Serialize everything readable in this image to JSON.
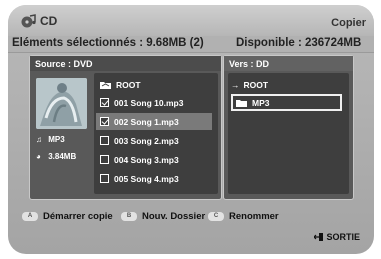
{
  "header": {
    "title": "CD",
    "action": "Copier"
  },
  "info": {
    "selected": "Eléments sélectionnés : 9.68MB  (2)",
    "available": "Disponible : 236724MB"
  },
  "source": {
    "title": "Source : DVD",
    "file_type": "MP3",
    "file_size": "3.84MB",
    "root_label": "ROOT",
    "items": [
      {
        "label": "001 Song 10.mp3",
        "checked": true
      },
      {
        "label": "002 Song 1.mp3",
        "checked": true
      },
      {
        "label": "003 Song 2.mp3",
        "checked": false
      },
      {
        "label": "004 Song 3.mp3",
        "checked": false
      },
      {
        "label": "005 Song 4.mp3",
        "checked": false
      }
    ]
  },
  "destination": {
    "title": "Vers : DD",
    "items": [
      {
        "label": "ROOT",
        "icon": "arrow-right-icon"
      },
      {
        "label": "MP3",
        "icon": "folder-icon"
      }
    ]
  },
  "footer": {
    "buttons": [
      {
        "key": "A",
        "label": "Démarrer copie"
      },
      {
        "key": "B",
        "label": "Nouv. Dossier"
      },
      {
        "key": "C",
        "label": "Renommer"
      }
    ],
    "exit_label": "SORTIE"
  },
  "colors": {
    "background": "#a9a9a9",
    "pane": "#595959",
    "list": "#3e3e3e",
    "selected_row": "#7a7a7a"
  }
}
